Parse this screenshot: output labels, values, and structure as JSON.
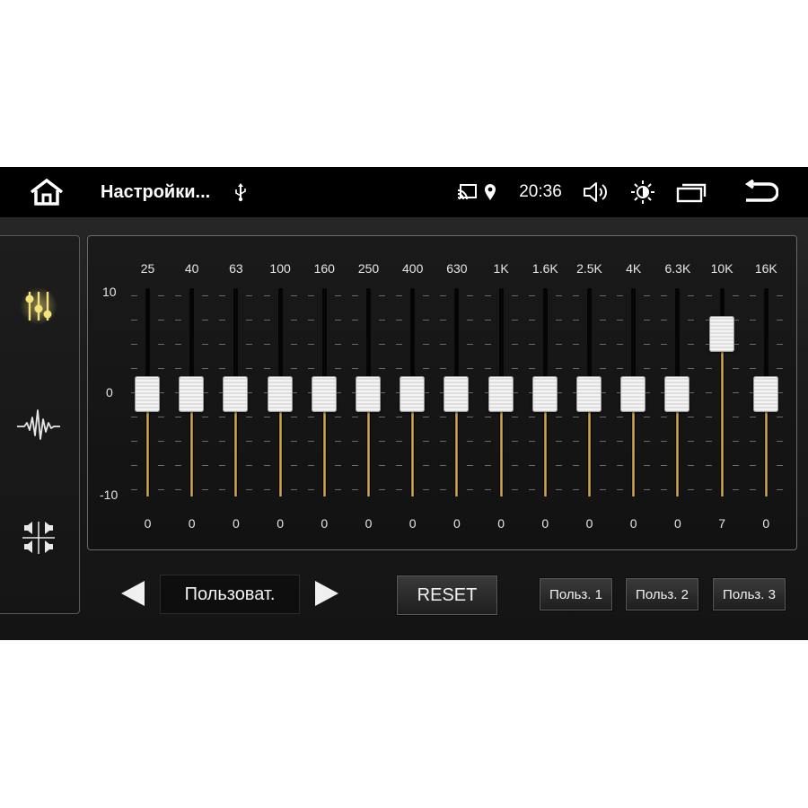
{
  "statusbar": {
    "title": "Настройки...",
    "time": "20:36",
    "icons": [
      "home-icon",
      "usb-icon",
      "cast-icon",
      "location-icon",
      "volume-icon",
      "brightness-icon",
      "recent-apps-icon",
      "back-icon"
    ]
  },
  "sidebar": {
    "items": [
      {
        "icon": "equalizer-icon",
        "active": true
      },
      {
        "icon": "sound-wave-icon",
        "active": false
      },
      {
        "icon": "speaker-balance-icon",
        "active": false
      }
    ]
  },
  "equalizer": {
    "scale": {
      "max": "10",
      "mid": "0",
      "min": "-10"
    },
    "range": [
      -10,
      10
    ],
    "bands": [
      {
        "freq": "25",
        "value": 0
      },
      {
        "freq": "40",
        "value": 0
      },
      {
        "freq": "63",
        "value": 0
      },
      {
        "freq": "100",
        "value": 0
      },
      {
        "freq": "160",
        "value": 0
      },
      {
        "freq": "250",
        "value": 0
      },
      {
        "freq": "400",
        "value": 0
      },
      {
        "freq": "630",
        "value": 0
      },
      {
        "freq": "1K",
        "value": 0
      },
      {
        "freq": "1.6K",
        "value": 0
      },
      {
        "freq": "2.5K",
        "value": 0
      },
      {
        "freq": "4K",
        "value": 0
      },
      {
        "freq": "6.3K",
        "value": 0
      },
      {
        "freq": "10K",
        "value": 7
      },
      {
        "freq": "16K",
        "value": 0
      }
    ]
  },
  "controls": {
    "preset": "Пользоват.",
    "reset_label": "RESET",
    "user1_label": "Польз. 1",
    "user2_label": "Польз. 2",
    "user3_label": "Польз. 3"
  },
  "colors": {
    "accent_gold": "#d9b25a",
    "active_icon": "#f5e27a"
  }
}
